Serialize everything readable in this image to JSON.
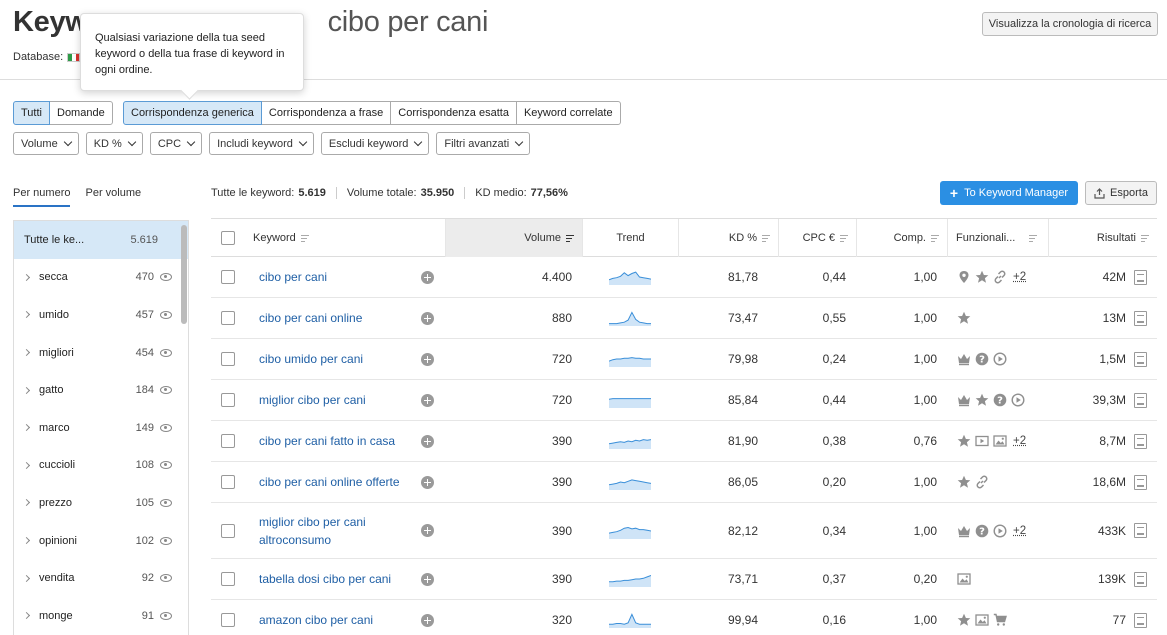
{
  "header": {
    "title_bold": "Keyw",
    "title_rest": "cibo per cani",
    "database_label": "Database:",
    "history_button": "Visualizza la cronologia di ricerca"
  },
  "tooltip": {
    "text": "Qualsiasi variazione della tua seed keyword o  della tua frase di keyword in ogni ordine."
  },
  "seg1": [
    {
      "label": "Tutti",
      "active": true
    },
    {
      "label": "Domande",
      "active": false
    }
  ],
  "seg2": [
    {
      "label": "Corrispondenza generica",
      "active": true
    },
    {
      "label": "Corrispondenza a frase",
      "active": false
    },
    {
      "label": "Corrispondenza esatta",
      "active": false
    },
    {
      "label": "Keyword correlate",
      "active": false
    }
  ],
  "filters": [
    "Volume",
    "KD %",
    "CPC",
    "Includi keyword",
    "Escludi keyword",
    "Filtri avanzati"
  ],
  "sort_tabs": [
    "Per numero",
    "Per volume"
  ],
  "summary": [
    {
      "label": "Tutte le keyword:",
      "value": "5.619"
    },
    {
      "label": "Volume totale:",
      "value": "35.950"
    },
    {
      "label": "KD medio:",
      "value": "77,56%"
    }
  ],
  "actions": {
    "keyword_manager": "To Keyword Manager",
    "export": "Esporta"
  },
  "sidebar": [
    {
      "label": "Tutte le ke...",
      "count": "5.619",
      "selected": true
    },
    {
      "label": "secca",
      "count": "470"
    },
    {
      "label": "umido",
      "count": "457"
    },
    {
      "label": "migliori",
      "count": "454"
    },
    {
      "label": "gatto",
      "count": "184"
    },
    {
      "label": "marco",
      "count": "149"
    },
    {
      "label": "cuccioli",
      "count": "108"
    },
    {
      "label": "prezzo",
      "count": "105"
    },
    {
      "label": "opinioni",
      "count": "102"
    },
    {
      "label": "vendita",
      "count": "92"
    },
    {
      "label": "monge",
      "count": "91"
    }
  ],
  "columns": {
    "keyword": "Keyword",
    "volume": "Volume",
    "trend": "Trend",
    "kd": "KD %",
    "cpc": "CPC €",
    "comp": "Comp.",
    "features": "Funzionali...",
    "results": "Risultati"
  },
  "colors": {
    "accent": "#2b8fe3",
    "link": "#1f5fa5",
    "active_bg": "#d6e8f7",
    "trend_line": "#3a8fd9",
    "trend_fill": "#cfe4f7"
  },
  "rows": [
    {
      "keyword": "cibo per cani",
      "volume": "4.400",
      "kd": "81,78",
      "cpc": "0,44",
      "comp": "1,00",
      "features": [
        "location-pin-icon",
        "star-icon",
        "link-icon"
      ],
      "more": "+2",
      "results": "42M",
      "trend": [
        0.3,
        0.4,
        0.45,
        0.55,
        0.8,
        0.6,
        0.75,
        0.85,
        0.5,
        0.45,
        0.4,
        0.35
      ]
    },
    {
      "keyword": "cibo per cani online",
      "volume": "880",
      "kd": "73,47",
      "cpc": "0,55",
      "comp": "1,00",
      "features": [
        "star-icon"
      ],
      "more": "",
      "results": "13M",
      "trend": [
        0.1,
        0.1,
        0.1,
        0.15,
        0.2,
        0.35,
        0.9,
        0.4,
        0.2,
        0.15,
        0.1,
        0.1
      ]
    },
    {
      "keyword": "cibo umido per cani",
      "volume": "720",
      "kd": "79,98",
      "cpc": "0,24",
      "comp": "1,00",
      "features": [
        "crown-icon",
        "question-icon",
        "play-icon"
      ],
      "more": "",
      "results": "1,5M",
      "trend": [
        0.35,
        0.45,
        0.5,
        0.5,
        0.55,
        0.55,
        0.6,
        0.55,
        0.55,
        0.5,
        0.5,
        0.5
      ]
    },
    {
      "keyword": "miglior cibo per cani",
      "volume": "720",
      "kd": "85,84",
      "cpc": "0,44",
      "comp": "1,00",
      "features": [
        "crown-icon",
        "star-icon",
        "question-icon",
        "play-icon"
      ],
      "more": "",
      "results": "39,3M",
      "trend": [
        0.55,
        0.6,
        0.6,
        0.6,
        0.6,
        0.6,
        0.6,
        0.6,
        0.6,
        0.6,
        0.6,
        0.6
      ]
    },
    {
      "keyword": "cibo per cani fatto in casa",
      "volume": "390",
      "kd": "81,90",
      "cpc": "0,38",
      "comp": "0,76",
      "features": [
        "star-icon",
        "video-icon",
        "image-icon"
      ],
      "more": "+2",
      "results": "8,7M",
      "trend": [
        0.3,
        0.35,
        0.4,
        0.45,
        0.4,
        0.5,
        0.45,
        0.55,
        0.5,
        0.6,
        0.55,
        0.6
      ]
    },
    {
      "keyword": "cibo per cani online offerte",
      "volume": "390",
      "kd": "86,05",
      "cpc": "0,20",
      "comp": "1,00",
      "features": [
        "star-icon",
        "link-icon"
      ],
      "more": "",
      "results": "18,6M",
      "trend": [
        0.3,
        0.35,
        0.4,
        0.5,
        0.45,
        0.55,
        0.65,
        0.6,
        0.55,
        0.5,
        0.45,
        0.4
      ]
    },
    {
      "keyword": "miglior cibo per cani altroconsumo",
      "volume": "390",
      "kd": "82,12",
      "cpc": "0,34",
      "comp": "1,00",
      "features": [
        "crown-icon",
        "question-icon",
        "play-icon"
      ],
      "more": "+2",
      "results": "433K",
      "trend": [
        0.35,
        0.4,
        0.45,
        0.55,
        0.7,
        0.75,
        0.65,
        0.7,
        0.6,
        0.6,
        0.55,
        0.5
      ]
    },
    {
      "keyword": "tabella dosi cibo per cani",
      "volume": "390",
      "kd": "73,71",
      "cpc": "0,37",
      "comp": "0,20",
      "features": [
        "image-icon"
      ],
      "more": "",
      "results": "139K",
      "trend": [
        0.3,
        0.3,
        0.35,
        0.35,
        0.4,
        0.4,
        0.45,
        0.5,
        0.5,
        0.55,
        0.65,
        0.75
      ]
    },
    {
      "keyword": "amazon cibo per cani",
      "volume": "320",
      "kd": "99,94",
      "cpc": "0,16",
      "comp": "1,00",
      "features": [
        "star-icon",
        "image-icon",
        "cart-icon"
      ],
      "more": "",
      "results": "77",
      "trend": [
        0.2,
        0.2,
        0.25,
        0.25,
        0.2,
        0.3,
        0.9,
        0.3,
        0.2,
        0.2,
        0.2,
        0.2
      ]
    }
  ]
}
